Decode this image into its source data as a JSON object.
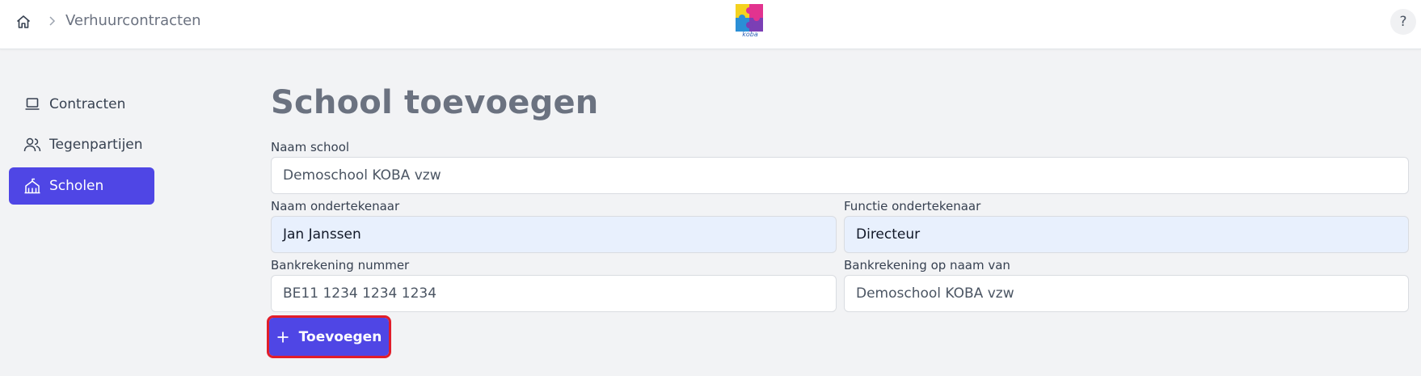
{
  "header": {
    "breadcrumb": "Verhuurcontracten",
    "help_label": "?",
    "logo_text": "koba"
  },
  "sidebar": {
    "items": [
      {
        "label": "Contracten",
        "icon": "laptop-icon",
        "active": false
      },
      {
        "label": "Tegenpartijen",
        "icon": "users-icon",
        "active": false
      },
      {
        "label": "Scholen",
        "icon": "school-building-icon",
        "active": true
      }
    ]
  },
  "main": {
    "title": "School toevoegen",
    "fields": {
      "school_name": {
        "label": "Naam school",
        "value": "Demoschool KOBA vzw"
      },
      "signer_name": {
        "label": "Naam ondertekenaar",
        "value": "Jan Janssen"
      },
      "signer_function": {
        "label": "Functie ondertekenaar",
        "value": "Directeur"
      },
      "bank_number": {
        "label": "Bankrekening nummer",
        "value": "BE11 1234 1234 1234"
      },
      "bank_holder": {
        "label": "Bankrekening op naam van",
        "value": "Demoschool KOBA vzw"
      }
    },
    "submit_label": "Toevoegen"
  },
  "colors": {
    "accent": "#4f46e5",
    "highlight": "#e11d2a",
    "background": "#f2f3f5"
  }
}
